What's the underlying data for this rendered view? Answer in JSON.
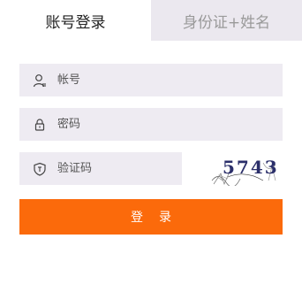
{
  "tabs": [
    {
      "label": "账号登录",
      "active": true
    },
    {
      "label": "身份证+姓名",
      "active": false
    }
  ],
  "form": {
    "account": {
      "placeholder": "帐号",
      "icon": "user-icon"
    },
    "password": {
      "placeholder": "密码",
      "icon": "lock-icon"
    },
    "captcha": {
      "placeholder": "验证码",
      "icon": "shield-icon",
      "image_text": "5743"
    }
  },
  "login_button": {
    "label": "登录",
    "color": "#fb6a0b"
  },
  "colors": {
    "field_bg": "#eeebf2",
    "inactive_tab_bg": "#ebe8ef",
    "inactive_tab_text": "#9a9a9a"
  }
}
